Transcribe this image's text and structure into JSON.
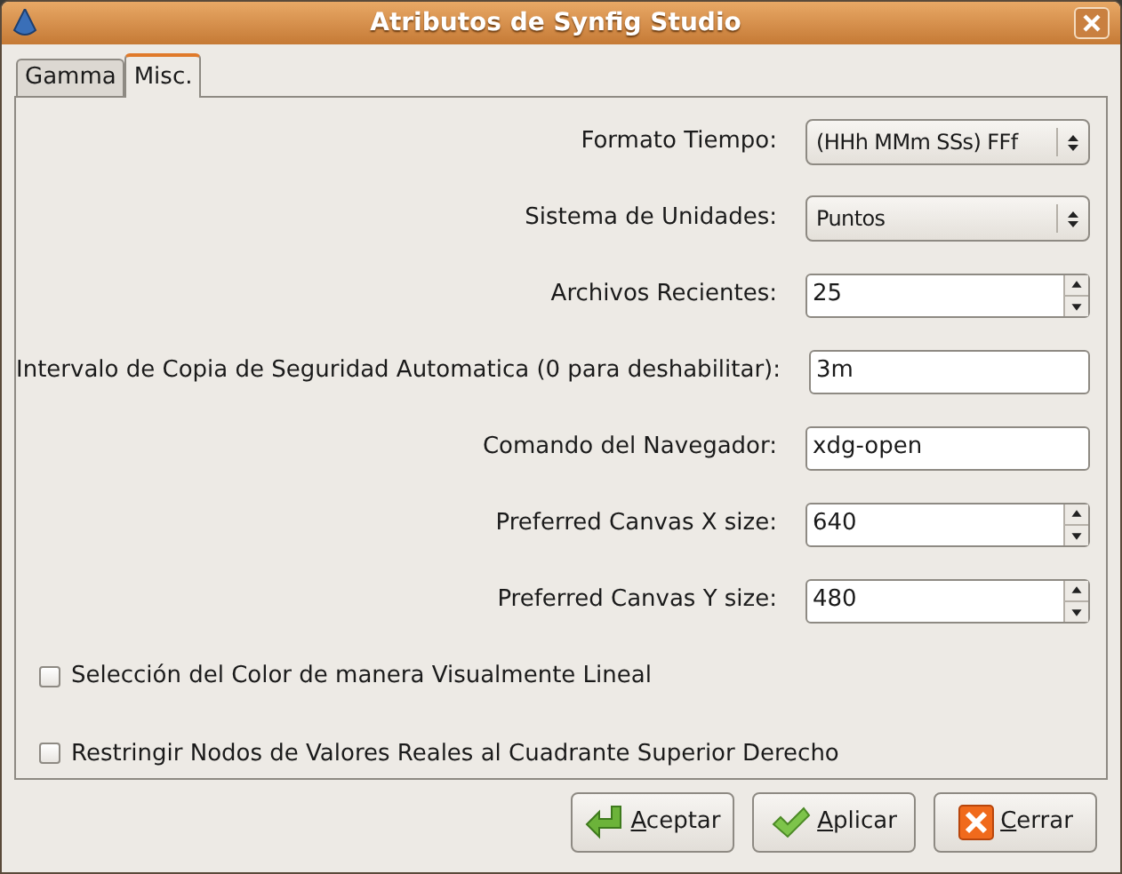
{
  "window": {
    "title": "Atributos de Synfig Studio"
  },
  "tabs": [
    {
      "label": "Gamma",
      "selected": false
    },
    {
      "label": "Misc.",
      "selected": true
    }
  ],
  "fields": [
    {
      "label": "Formato Tiempo:",
      "kind": "combo",
      "value": "(HHh MMm SSs) FFf"
    },
    {
      "label": "Sistema de Unidades:",
      "kind": "combo",
      "value": "Puntos"
    },
    {
      "label": "Archivos Recientes:",
      "kind": "spin",
      "value": "25"
    },
    {
      "label": "Intervalo de Copia de Seguridad Automatica (0 para deshabilitar):",
      "kind": "entry",
      "value": "3m"
    },
    {
      "label": "Comando del Navegador:",
      "kind": "entry",
      "value": "xdg-open"
    },
    {
      "label": "Preferred Canvas X size:",
      "kind": "spin",
      "value": "640"
    },
    {
      "label": "Preferred Canvas Y size:",
      "kind": "spin",
      "value": "480"
    }
  ],
  "checkboxes": [
    {
      "label": "Selección del Color de manera Visualmente Lineal",
      "checked": false
    },
    {
      "label": "Restringir Nodos de Valores Reales al Cuadrante Superior Derecho",
      "checked": false
    }
  ],
  "buttons": [
    {
      "label": "Aceptar",
      "kind": "accept"
    },
    {
      "label": "Aplicar",
      "kind": "apply"
    },
    {
      "label": "Cerrar",
      "kind": "close"
    }
  ]
}
